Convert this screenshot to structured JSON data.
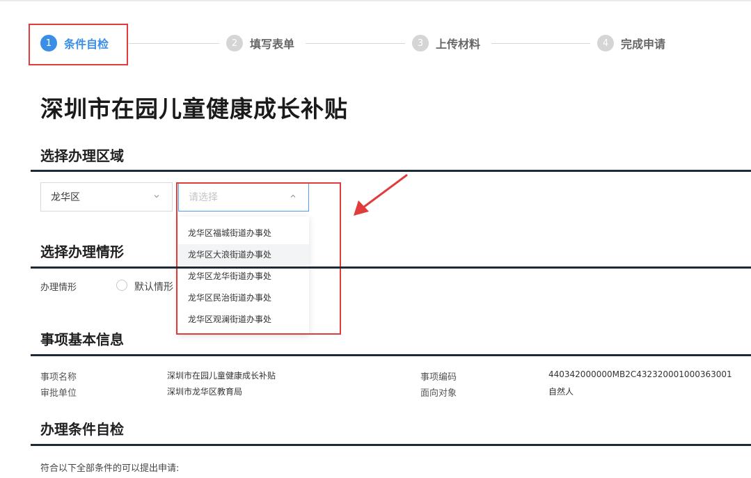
{
  "steps": [
    {
      "num": "1",
      "label": "条件自检",
      "active": true
    },
    {
      "num": "2",
      "label": "填写表单",
      "active": false
    },
    {
      "num": "3",
      "label": "上传材料",
      "active": false
    },
    {
      "num": "4",
      "label": "完成申请",
      "active": false
    }
  ],
  "page_title": "深圳市在园儿童健康成长补贴",
  "region_section": {
    "title": "选择办理区域",
    "district_select": {
      "value": "龙华区"
    },
    "subdistrict_select": {
      "placeholder": "请选择"
    },
    "options": [
      "龙华区福城街道办事处",
      "龙华区大浪街道办事处",
      "龙华区龙华街道办事处",
      "龙华区民治街道办事处",
      "龙华区观澜街道办事处"
    ]
  },
  "scenario_section": {
    "title": "选择办理情形",
    "label": "办理情形",
    "radio_label": "默认情形"
  },
  "basic_info": {
    "title": "事项基本信息",
    "name_label": "事项名称",
    "name_value": "深圳市在园儿童健康成长补贴",
    "code_label": "事项编码",
    "code_value": "440342000000MB2C432320001000363001",
    "dept_label": "审批单位",
    "dept_value": "深圳市龙华区教育局",
    "target_label": "面向对象",
    "target_value": "自然人"
  },
  "check_section": {
    "title": "办理条件自检",
    "intro": "符合以下全部条件的可以提出申请:"
  },
  "colors": {
    "accent": "#3a8ee6",
    "annotation": "#e23b3b"
  }
}
